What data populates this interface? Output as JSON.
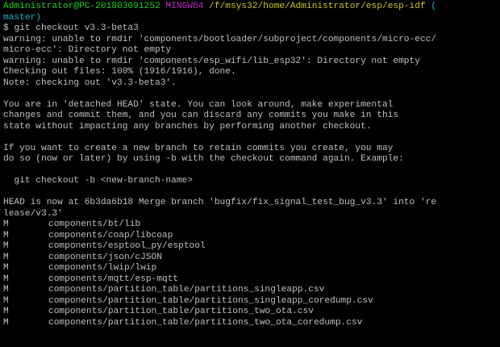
{
  "window": {
    "background": "#000000",
    "foreground": "#c0c0c0"
  },
  "prompt": {
    "user_host": "Administrator@PC-201803091252",
    "system": "MINGW64",
    "path": "/f/msys32/home/Administrator/esp/esp-idf",
    "branch_open": "(",
    "branch_name": "master)",
    "symbol": "$",
    "command": "git checkout v3.3-beta3",
    "colors": {
      "user_host": "#1fd41f",
      "system": "#c026c0",
      "path": "#c8c81e",
      "branch": "#1ab6c8"
    }
  },
  "output_lines": [
    "warning: unable to rmdir 'components/bootloader/subproject/components/micro-ecc/",
    "micro-ecc': Directory not empty",
    "warning: unable to rmdir 'components/esp_wifi/lib_esp32': Directory not empty",
    "Checking out files: 100% (1916/1916), done.",
    "Note: checking out 'v3.3-beta3'.",
    "",
    "You are in 'detached HEAD' state. You can look around, make experimental",
    "changes and commit them, and you can discard any commits you make in this",
    "state without impacting any branches by performing another checkout.",
    "",
    "If you want to create a new branch to retain commits you create, you may",
    "do so (now or later) by using -b with the checkout command again. Example:",
    "",
    "  git checkout -b <new-branch-name>",
    "",
    "HEAD is now at 6b3da6b18 Merge branch 'bugfix/fix_signal_test_bug_v3.3' into 're",
    "lease/v3.3'"
  ],
  "modified_files": [
    {
      "status": "M",
      "path": "components/bt/lib"
    },
    {
      "status": "M",
      "path": "components/coap/libcoap"
    },
    {
      "status": "M",
      "path": "components/esptool_py/esptool"
    },
    {
      "status": "M",
      "path": "components/json/cJSON"
    },
    {
      "status": "M",
      "path": "components/lwip/lwip"
    },
    {
      "status": "M",
      "path": "components/mqtt/esp-mqtt"
    },
    {
      "status": "M",
      "path": "components/partition_table/partitions_singleapp.csv"
    },
    {
      "status": "M",
      "path": "components/partition_table/partitions_singleapp_coredump.csv"
    },
    {
      "status": "M",
      "path": "components/partition_table/partitions_two_ota.csv"
    },
    {
      "status": "M",
      "path": "components/partition_table/partitions_two_ota_coredump.csv"
    }
  ]
}
